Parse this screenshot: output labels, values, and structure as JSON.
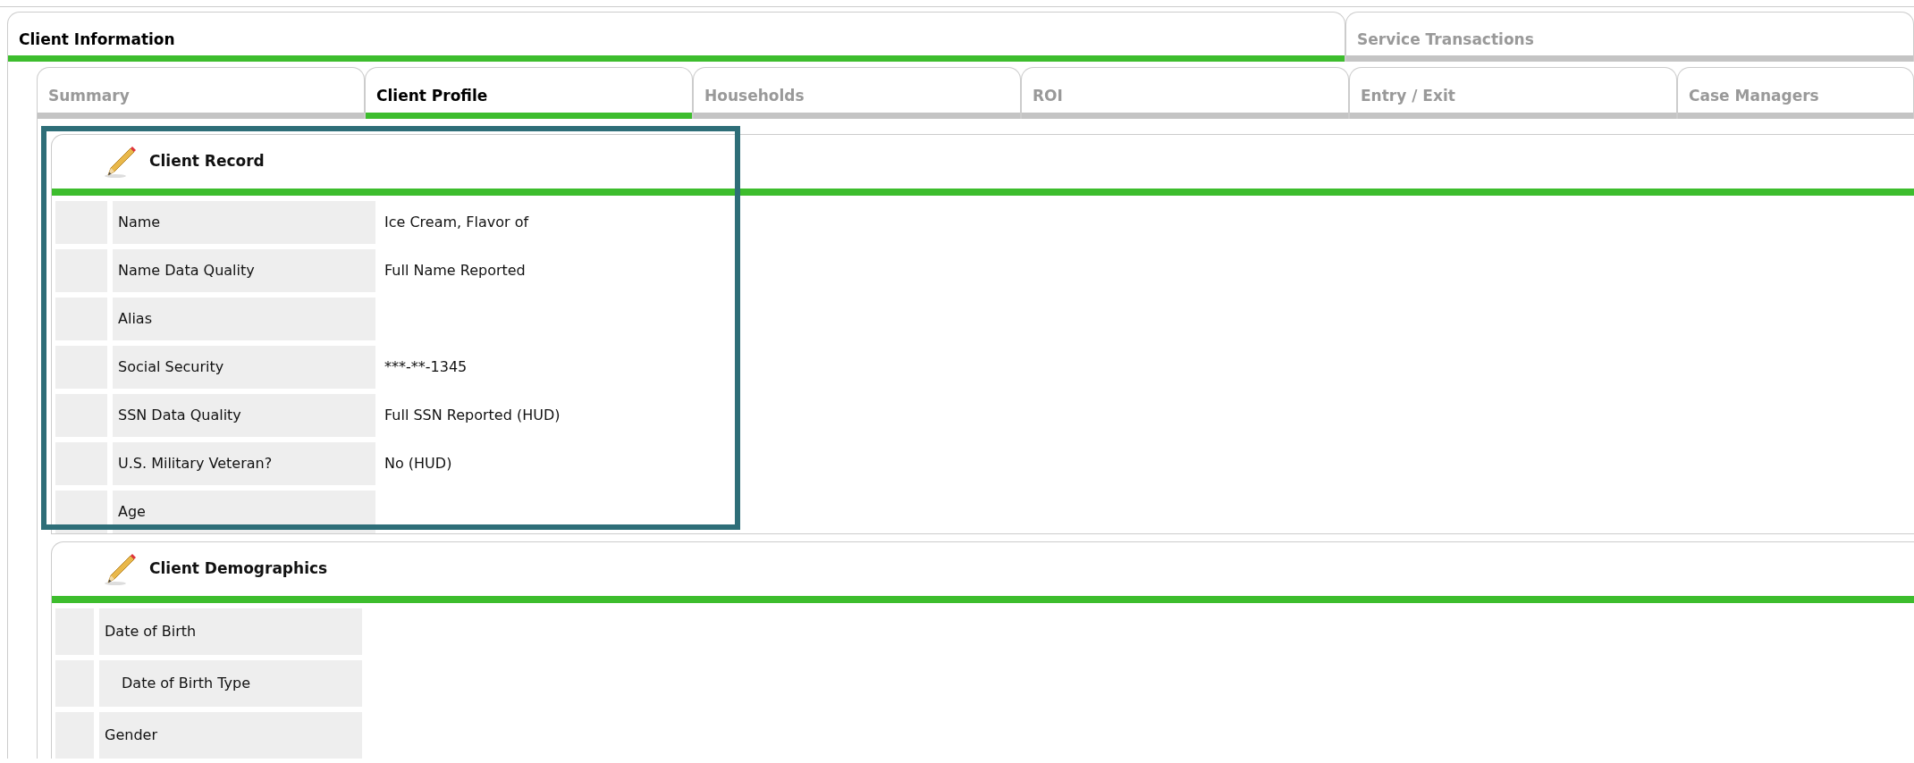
{
  "outer_tabs": [
    {
      "label": "Client Information",
      "selected": true
    },
    {
      "label": "Service Transactions",
      "selected": false
    }
  ],
  "inner_tabs": [
    {
      "label": "Summary",
      "selected": false
    },
    {
      "label": "Client Profile",
      "selected": true
    },
    {
      "label": "Households",
      "selected": false
    },
    {
      "label": "ROI",
      "selected": false
    },
    {
      "label": "Entry / Exit",
      "selected": false
    },
    {
      "label": "Case Managers",
      "selected": false
    }
  ],
  "panels": [
    {
      "title": "Client Record",
      "highlighted": true,
      "rows": [
        {
          "label": "Name",
          "value": "Ice Cream, Flavor of",
          "indented": false
        },
        {
          "label": "Name Data Quality",
          "value": "Full Name Reported",
          "indented": false
        },
        {
          "label": "Alias",
          "indented": false
        },
        {
          "label": "Social Security",
          "value": "***-**-1345",
          "indented": false
        },
        {
          "label": "SSN Data Quality",
          "value": "Full SSN Reported (HUD)",
          "indented": false
        },
        {
          "label": "U.S. Military Veteran?",
          "value": "No (HUD)",
          "indented": false
        },
        {
          "label": "Age",
          "indented": false
        }
      ]
    },
    {
      "title": "Client Demographics",
      "highlighted": false,
      "rows": [
        {
          "label": "Date of Birth",
          "indented": false
        },
        {
          "label": "Date of Birth Type",
          "indented": true
        },
        {
          "label": "Gender",
          "indented": false
        }
      ]
    }
  ]
}
